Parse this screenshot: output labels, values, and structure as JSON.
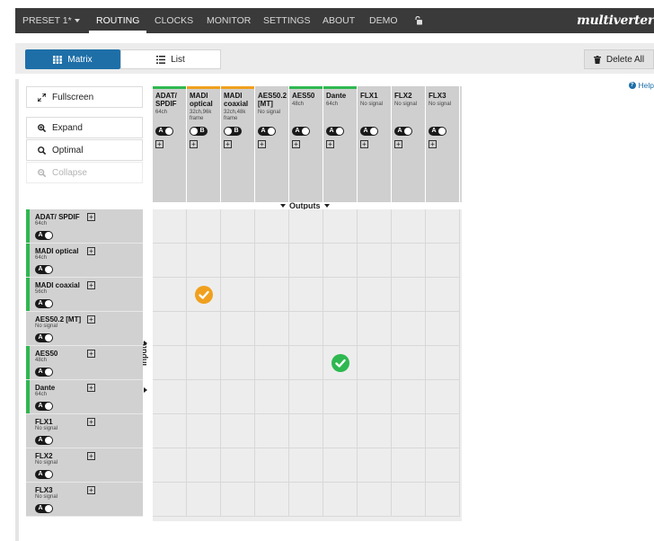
{
  "nav": {
    "items": [
      {
        "label": "PRESET 1*",
        "caret": true
      },
      {
        "label": "ROUTING",
        "active": true
      },
      {
        "label": "CLOCKS"
      },
      {
        "label": "MONITOR"
      },
      {
        "label": "SETTINGS"
      },
      {
        "label": "ABOUT"
      },
      {
        "label": "DEMO"
      }
    ],
    "lock_icon": "unlock-icon",
    "brand": "multiverter"
  },
  "toolbar": {
    "matrix_label": "Matrix",
    "list_label": "List",
    "delete_all_label": "Delete All",
    "help_label": "Help"
  },
  "side": {
    "fullscreen": "Fullscreen",
    "expand": "Expand",
    "optimal": "Optimal",
    "collapse": "Collapse"
  },
  "matrix": {
    "outputs_label": "Outputs",
    "inputs_label": "Inputs",
    "colors": {
      "green": "#2eb84f",
      "orange": "#f0a01e",
      "grey": "#cfcfcf"
    },
    "columns": [
      {
        "name": "ADAT/ SPDIF",
        "sub": "64ch",
        "mode": "A",
        "status": "green"
      },
      {
        "name": "MADI optical",
        "sub": "32ch,96k frame",
        "mode": "B",
        "status": "orange"
      },
      {
        "name": "MADI coaxial",
        "sub": "32ch,48k frame",
        "mode": "B",
        "status": "orange"
      },
      {
        "name": "AES50.2 [MT]",
        "sub": "No signal",
        "mode": "A",
        "status": "none"
      },
      {
        "name": "AES50",
        "sub": "48ch",
        "mode": "A",
        "status": "green"
      },
      {
        "name": "Dante",
        "sub": "64ch",
        "mode": "A",
        "status": "green"
      },
      {
        "name": "FLX1",
        "sub": "No signal",
        "mode": "A",
        "status": "none"
      },
      {
        "name": "FLX2",
        "sub": "No signal",
        "mode": "A",
        "status": "none"
      },
      {
        "name": "FLX3",
        "sub": "No signal",
        "mode": "A",
        "status": "none"
      }
    ],
    "rows": [
      {
        "name": "ADAT/ SPDIF",
        "sub": "64ch",
        "mode": "A",
        "status": "green"
      },
      {
        "name": "MADI optical",
        "sub": "64ch",
        "mode": "A",
        "status": "green"
      },
      {
        "name": "MADI coaxial",
        "sub": "56ch",
        "mode": "A",
        "status": "green"
      },
      {
        "name": "AES50.2 [MT]",
        "sub": "No signal",
        "mode": "A",
        "status": "none"
      },
      {
        "name": "AES50",
        "sub": "48ch",
        "mode": "A",
        "status": "green"
      },
      {
        "name": "Dante",
        "sub": "64ch",
        "mode": "A",
        "status": "green"
      },
      {
        "name": "FLX1",
        "sub": "No signal",
        "mode": "A",
        "status": "none"
      },
      {
        "name": "FLX2",
        "sub": "No signal",
        "mode": "A",
        "status": "none"
      },
      {
        "name": "FLX3",
        "sub": "No signal",
        "mode": "A",
        "status": "none"
      }
    ],
    "routes": [
      {
        "row": 2,
        "col": 1,
        "color": "orange"
      },
      {
        "row": 4,
        "col": 5,
        "color": "green"
      }
    ]
  }
}
